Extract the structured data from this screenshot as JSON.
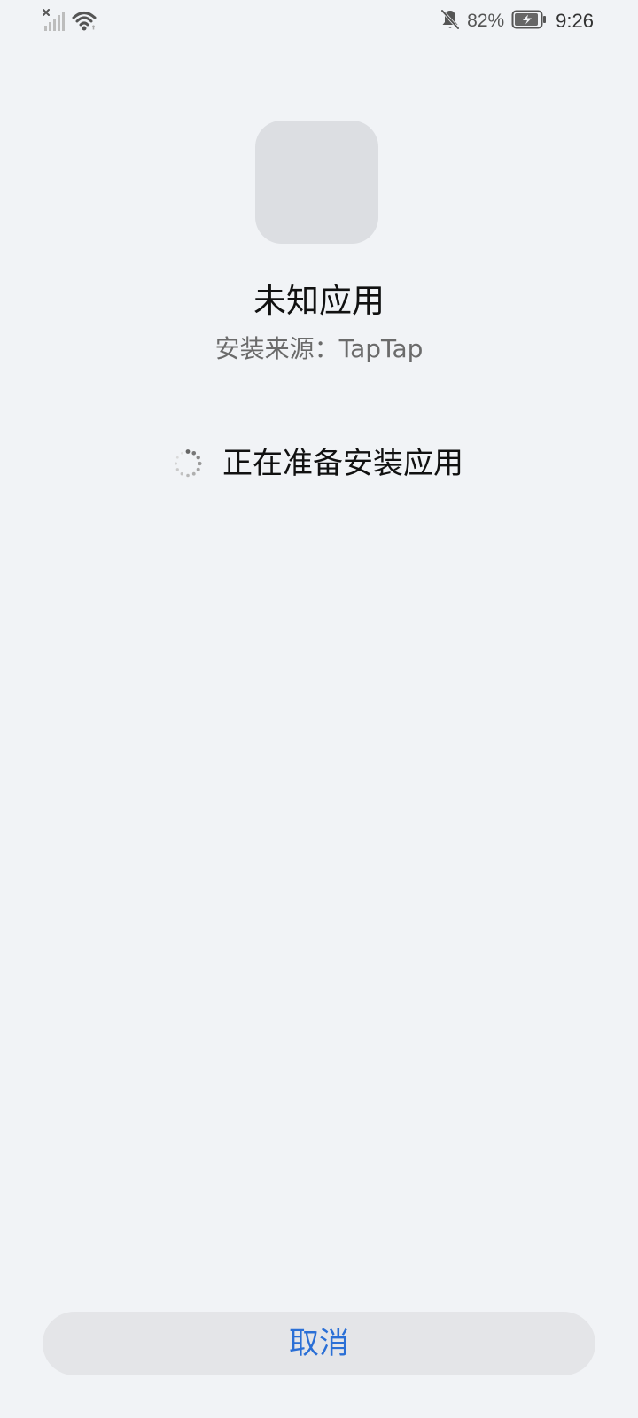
{
  "status_bar": {
    "signal_icon": "signal-off-icon",
    "wifi_icon": "wifi-icon",
    "mute_icon": "bell-off-icon",
    "battery_percent": "82%",
    "battery_icon": "battery-charging-icon",
    "time": "9:26"
  },
  "app": {
    "name": "未知应用",
    "source": "安装来源：TapTap"
  },
  "progress": {
    "spinner_icon": "loading-spinner-icon",
    "text": "正在准备安装应用"
  },
  "actions": {
    "cancel_label": "取消"
  },
  "colors": {
    "background": "#f1f3f6",
    "accent": "#2a6fd6",
    "icon_placeholder": "#dcdee2",
    "button_bg": "#e4e5e8"
  }
}
